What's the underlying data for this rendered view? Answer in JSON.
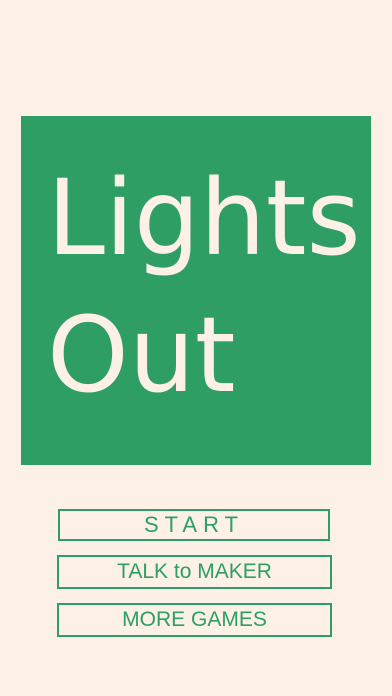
{
  "title": {
    "line1": "Lights",
    "line2": "Out"
  },
  "menu": {
    "start_label": "START",
    "talk_label": "TALK to MAKER",
    "more_label": "MORE GAMES"
  },
  "colors": {
    "background": "#fdf0e7",
    "accent": "#2e9e64",
    "title_text": "#fdf0e7"
  }
}
